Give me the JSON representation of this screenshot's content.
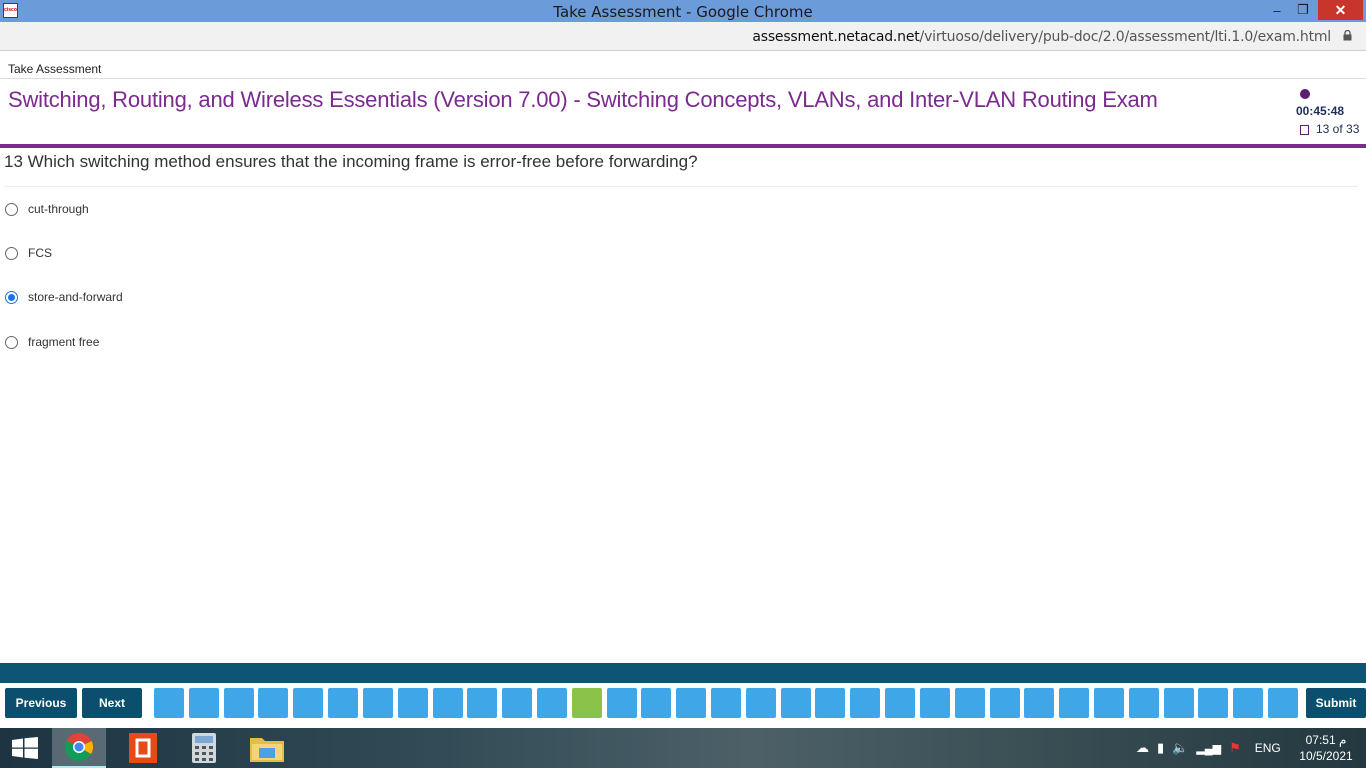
{
  "window": {
    "title": "Take Assessment - Google Chrome",
    "min_glyph": "–",
    "max_glyph": "❐",
    "close_glyph": "✕"
  },
  "address": {
    "domain": "assessment.netacad.net",
    "path": "/virtuoso/delivery/pub-doc/2.0/assessment/lti.1.0/exam.html"
  },
  "page": {
    "tab_label": "Take Assessment",
    "exam_title": "Switching, Routing, and Wireless Essentials (Version 7.00) - Switching Concepts, VLANs, and Inter-VLAN Routing Exam",
    "timer": "00:45:48",
    "question_count": "13 of 33"
  },
  "question": {
    "text": "13  Which switching method ensures that the incoming frame is error-free before forwarding?",
    "options": [
      {
        "label": "cut-through",
        "checked": false
      },
      {
        "label": "FCS",
        "checked": false
      },
      {
        "label": "store-and-forward",
        "checked": true
      },
      {
        "label": "fragment free",
        "checked": false
      }
    ]
  },
  "nav": {
    "previous_label": "Previous",
    "next_label": "Next",
    "submit_label": "Submit",
    "total_questions": 33,
    "current_question": 13,
    "colors": {
      "default": "#3fa6e8",
      "current": "#8bc34a",
      "button": "#0c4e6d"
    }
  },
  "taskbar": {
    "language": "ENG",
    "time": "07:51 م",
    "date": "10/5/2021",
    "apps": [
      "windows-start-icon",
      "chrome-icon",
      "office-icon",
      "calculator-icon",
      "file-explorer-icon"
    ]
  }
}
